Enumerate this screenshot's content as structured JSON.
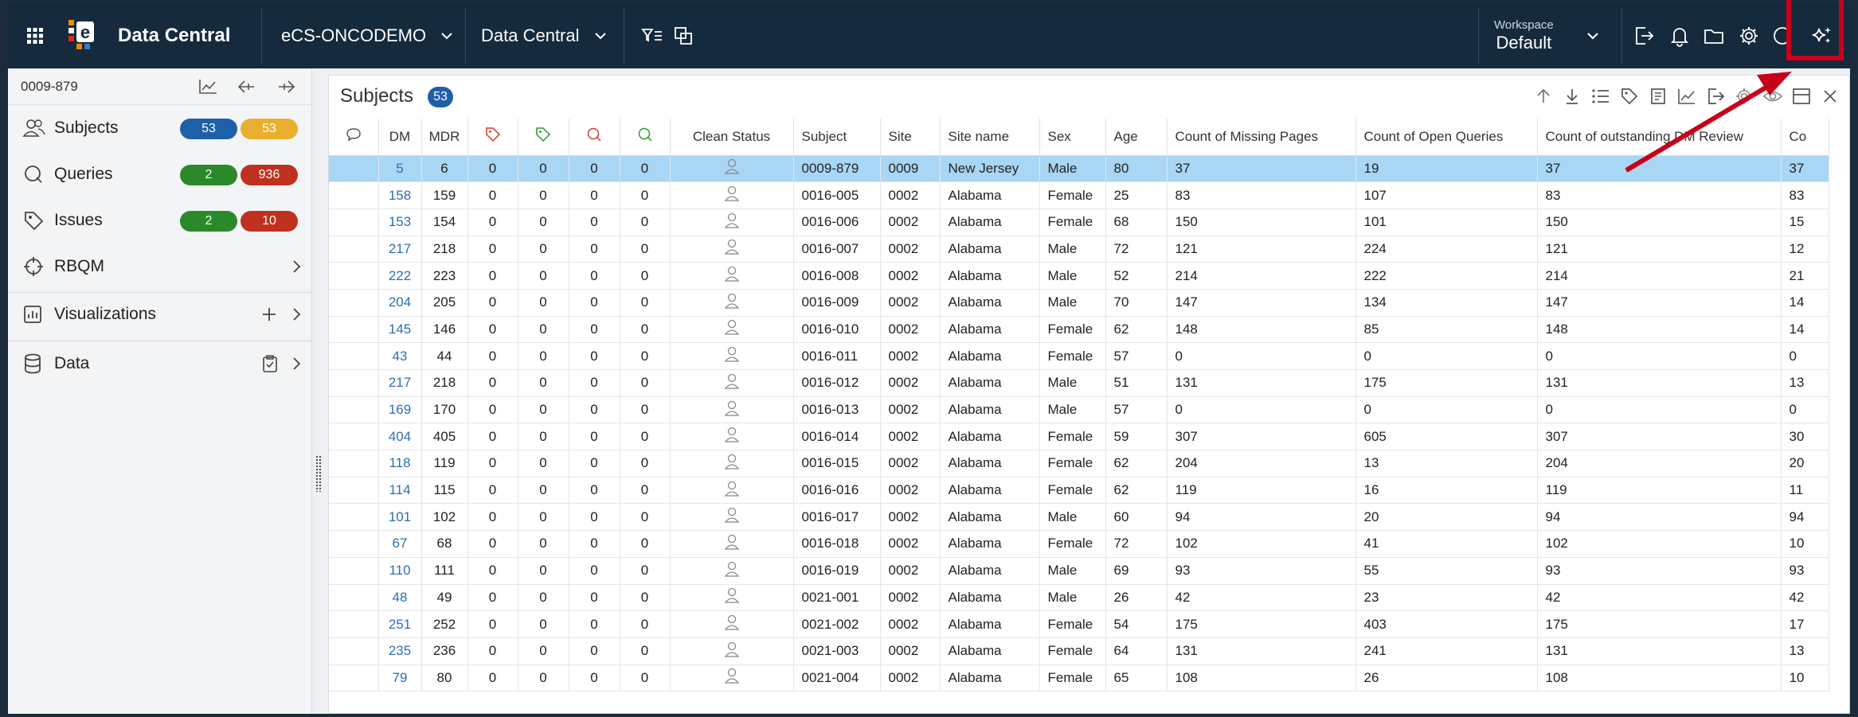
{
  "topbar": {
    "brand": "Data Central",
    "study": "eCS-ONCODEMO",
    "module": "Data Central",
    "workspace_label": "Workspace",
    "workspace_value": "Default"
  },
  "sidebar": {
    "current_subject": "0009-879",
    "items": [
      {
        "label": "Subjects",
        "badges": [
          "53",
          "53"
        ]
      },
      {
        "label": "Queries",
        "badges": [
          "2",
          "936"
        ]
      },
      {
        "label": "Issues",
        "badges": [
          "2",
          "10"
        ]
      },
      {
        "label": "RBQM"
      },
      {
        "label": "Visualizations"
      },
      {
        "label": "Data"
      }
    ]
  },
  "panel": {
    "title": "Subjects",
    "count": "53"
  },
  "table": {
    "columns": [
      "",
      "DM",
      "MDR",
      "",
      "",
      "",
      "",
      "Clean Status",
      "Subject",
      "Site",
      "Site name",
      "Sex",
      "Age",
      "Count of Missing Pages",
      "Count of Open Queries",
      "Count of outstanding DM Review",
      "Co"
    ],
    "rows": [
      [
        "5",
        "6",
        "0",
        "0",
        "0",
        "0",
        "0009-879",
        "0009",
        "New Jersey",
        "Male",
        "80",
        "37",
        "19",
        "37",
        "37"
      ],
      [
        "158",
        "159",
        "0",
        "0",
        "0",
        "0",
        "0016-005",
        "0002",
        "Alabama",
        "Female",
        "25",
        "83",
        "107",
        "83",
        "83"
      ],
      [
        "153",
        "154",
        "0",
        "0",
        "0",
        "0",
        "0016-006",
        "0002",
        "Alabama",
        "Female",
        "68",
        "150",
        "101",
        "150",
        "15"
      ],
      [
        "217",
        "218",
        "0",
        "0",
        "0",
        "0",
        "0016-007",
        "0002",
        "Alabama",
        "Male",
        "72",
        "121",
        "224",
        "121",
        "12"
      ],
      [
        "222",
        "223",
        "0",
        "0",
        "0",
        "0",
        "0016-008",
        "0002",
        "Alabama",
        "Male",
        "52",
        "214",
        "222",
        "214",
        "21"
      ],
      [
        "204",
        "205",
        "0",
        "0",
        "0",
        "0",
        "0016-009",
        "0002",
        "Alabama",
        "Male",
        "70",
        "147",
        "134",
        "147",
        "14"
      ],
      [
        "145",
        "146",
        "0",
        "0",
        "0",
        "0",
        "0016-010",
        "0002",
        "Alabama",
        "Female",
        "62",
        "148",
        "85",
        "148",
        "14"
      ],
      [
        "43",
        "44",
        "0",
        "0",
        "0",
        "0",
        "0016-011",
        "0002",
        "Alabama",
        "Female",
        "57",
        "0",
        "0",
        "0",
        "0"
      ],
      [
        "217",
        "218",
        "0",
        "0",
        "0",
        "0",
        "0016-012",
        "0002",
        "Alabama",
        "Male",
        "51",
        "131",
        "175",
        "131",
        "13"
      ],
      [
        "169",
        "170",
        "0",
        "0",
        "0",
        "0",
        "0016-013",
        "0002",
        "Alabama",
        "Male",
        "57",
        "0",
        "0",
        "0",
        "0"
      ],
      [
        "404",
        "405",
        "0",
        "0",
        "0",
        "0",
        "0016-014",
        "0002",
        "Alabama",
        "Female",
        "59",
        "307",
        "605",
        "307",
        "30"
      ],
      [
        "118",
        "119",
        "0",
        "0",
        "0",
        "0",
        "0016-015",
        "0002",
        "Alabama",
        "Female",
        "62",
        "204",
        "13",
        "204",
        "20"
      ],
      [
        "114",
        "115",
        "0",
        "0",
        "0",
        "0",
        "0016-016",
        "0002",
        "Alabama",
        "Female",
        "62",
        "119",
        "16",
        "119",
        "11"
      ],
      [
        "101",
        "102",
        "0",
        "0",
        "0",
        "0",
        "0016-017",
        "0002",
        "Alabama",
        "Male",
        "60",
        "94",
        "20",
        "94",
        "94"
      ],
      [
        "67",
        "68",
        "0",
        "0",
        "0",
        "0",
        "0016-018",
        "0002",
        "Alabama",
        "Female",
        "72",
        "102",
        "41",
        "102",
        "10"
      ],
      [
        "110",
        "111",
        "0",
        "0",
        "0",
        "0",
        "0016-019",
        "0002",
        "Alabama",
        "Male",
        "69",
        "93",
        "55",
        "93",
        "93"
      ],
      [
        "48",
        "49",
        "0",
        "0",
        "0",
        "0",
        "0021-001",
        "0002",
        "Alabama",
        "Male",
        "26",
        "42",
        "23",
        "42",
        "42"
      ],
      [
        "251",
        "252",
        "0",
        "0",
        "0",
        "0",
        "0021-002",
        "0002",
        "Alabama",
        "Female",
        "54",
        "175",
        "403",
        "175",
        "17"
      ],
      [
        "235",
        "236",
        "0",
        "0",
        "0",
        "0",
        "0021-003",
        "0002",
        "Alabama",
        "Female",
        "64",
        "131",
        "241",
        "131",
        "13"
      ],
      [
        "79",
        "80",
        "0",
        "0",
        "0",
        "0",
        "0021-004",
        "0002",
        "Alabama",
        "Female",
        "65",
        "108",
        "26",
        "108",
        "10"
      ]
    ]
  },
  "colors": {
    "topbar": "#152a3c",
    "blue_badge": "#1f5fa8",
    "yellow_badge": "#e8b02e",
    "green_badge": "#2a8a2a",
    "red_badge": "#c0301f",
    "selected_row": "#a9d6f5",
    "annotation": "#c8001a"
  }
}
